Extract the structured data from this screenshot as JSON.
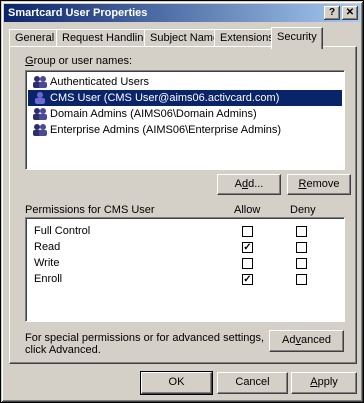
{
  "window": {
    "title": "Smartcard User Properties",
    "help_glyph": "?",
    "close_glyph": "✕"
  },
  "tabs": [
    "General",
    "Request Handling",
    "Subject Name",
    "Extensions",
    "Security"
  ],
  "active_tab": "Security",
  "security": {
    "group_label_access_key": "G",
    "group_label_rest": "roup or user names:",
    "users": [
      {
        "name": "Authenticated Users",
        "selected": false
      },
      {
        "name": "CMS User (CMS User@aims06.activcard.com)",
        "selected": true
      },
      {
        "name": "Domain Admins (AIMS06\\Domain Admins)",
        "selected": false
      },
      {
        "name": "Enterprise Admins (AIMS06\\Enterprise Admins)",
        "selected": false
      }
    ],
    "add_button": {
      "prefix": "A",
      "access_key": "d",
      "suffix": "d..."
    },
    "remove_button": {
      "access_key": "R",
      "suffix": "emove"
    },
    "permissions_header": "Permissions for CMS User",
    "allow_header": "Allow",
    "deny_header": "Deny",
    "permissions": [
      {
        "name": "Full Control",
        "allow": false,
        "deny": false
      },
      {
        "name": "Read",
        "allow": true,
        "deny": false
      },
      {
        "name": "Write",
        "allow": false,
        "deny": false
      },
      {
        "name": "Enroll",
        "allow": true,
        "deny": false
      }
    ],
    "advanced_note_line1": "For special permissions or for advanced settings,",
    "advanced_note_line2": "click Advanced.",
    "advanced_button": {
      "prefix": "Ad",
      "access_key": "v",
      "suffix": "anced"
    }
  },
  "footer": {
    "ok_label": "OK",
    "cancel_label": "Cancel",
    "apply_access_key": "A",
    "apply_suffix": "pply"
  },
  "colors": {
    "face": "#d4d0c8",
    "title_gradient_start": "#0a246a",
    "title_gradient_end": "#a6caf0",
    "selection": "#0a246a"
  }
}
